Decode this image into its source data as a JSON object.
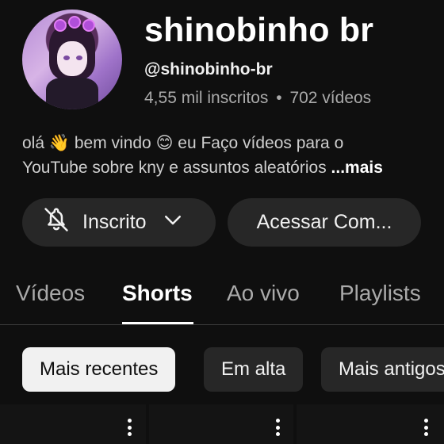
{
  "channel": {
    "name": "shinobinho br",
    "handle": "@shinobinho-br",
    "subscribers": "4,55 mil inscritos",
    "separator": "•",
    "videos": "702 vídeos",
    "description_line1": "olá 👋 bem vindo 😊 eu Faço vídeos para o",
    "description_line2": "YouTube  sobre kny e assuntos aleatórios ",
    "more_label": "...mais"
  },
  "actions": {
    "subscribed_label": "Inscrito",
    "access_label": "Acessar Com..."
  },
  "tabs": [
    {
      "label": "Vídeos"
    },
    {
      "label": "Shorts",
      "active": true
    },
    {
      "label": "Ao vivo"
    },
    {
      "label": "Playlists"
    }
  ],
  "chips": [
    {
      "label": "Mais recentes",
      "active": true
    },
    {
      "label": "Em alta"
    },
    {
      "label": "Mais antigos"
    }
  ],
  "icons": {
    "bell": "bell-off-icon",
    "chevron": "chevron-down-icon",
    "more": "more-vert-icon"
  }
}
